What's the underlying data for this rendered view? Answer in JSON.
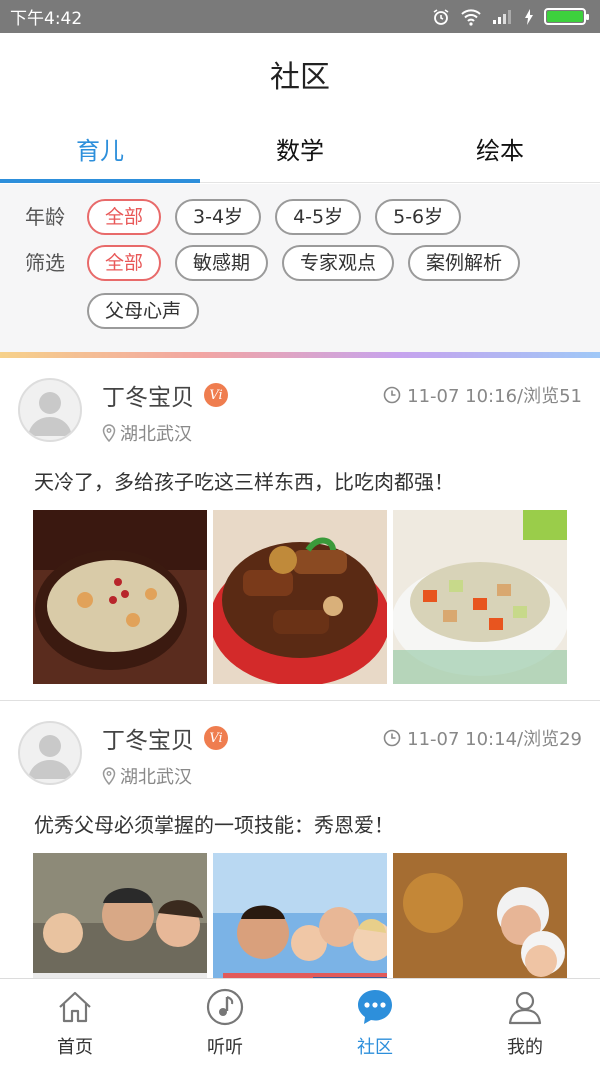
{
  "status": {
    "time": "下午4:42"
  },
  "header": {
    "title": "社区"
  },
  "tabs": [
    {
      "label": "育儿",
      "active": true
    },
    {
      "label": "数学",
      "active": false
    },
    {
      "label": "绘本",
      "active": false
    }
  ],
  "filters": {
    "age_label": "年龄",
    "age_options": [
      "全部",
      "3-4岁",
      "4-5岁",
      "5-6岁"
    ],
    "age_selected": "全部",
    "filter_label": "筛选",
    "filter_options": [
      "全部",
      "敏感期",
      "专家观点",
      "案例解析",
      "父母心声"
    ],
    "filter_selected": "全部"
  },
  "posts": [
    {
      "author": "丁冬宝贝",
      "badge": "Vi",
      "location": "湖北武汉",
      "time_views": "11-07 10:16/浏览51",
      "text": "天冷了，多给孩子吃这三样东西，比吃肉都强！",
      "images": [
        "porridge-photo",
        "braised-ribs-photo",
        "diced-vegetables-photo"
      ]
    },
    {
      "author": "丁冬宝贝",
      "badge": "Vi",
      "location": "湖北武汉",
      "time_views": "11-07 10:14/浏览29",
      "text": "优秀父母必须掌握的一项技能：秀恩爱！",
      "images": [
        "family-kiss-photo",
        "happy-family-photo",
        "elderly-couple-photo"
      ]
    }
  ],
  "tabbar": [
    {
      "label": "首页",
      "icon": "home-icon",
      "active": false
    },
    {
      "label": "听听",
      "icon": "music-note-icon",
      "active": false
    },
    {
      "label": "社区",
      "icon": "chat-bubble-icon",
      "active": true
    },
    {
      "label": "我的",
      "icon": "person-icon",
      "active": false
    }
  ],
  "colors": {
    "accent": "#2d8fdb",
    "selected_chip": "#e85858",
    "badge": "#ef7d4f"
  }
}
